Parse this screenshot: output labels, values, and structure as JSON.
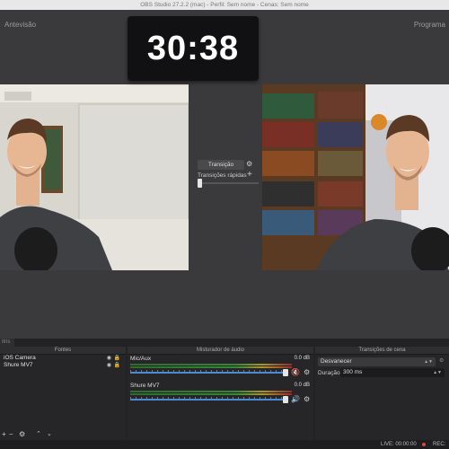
{
  "window": {
    "title": "OBS Studio 27.2.2 (mac) - Perfil: Sem nome - Cenas: Sem nome"
  },
  "preview_label": "Antevisão",
  "program_label": "Programa",
  "timer": "30:38",
  "transition": {
    "button_label": "Transição",
    "quick_label": "Transições rápidas"
  },
  "dock": {
    "tab_label": "itris",
    "sources": {
      "title": "Fontes",
      "items": [
        "iOS Camera",
        "Shure MV7"
      ]
    },
    "mixer": {
      "title": "Misturador de áudio",
      "channels": [
        {
          "name": "Mic/Aux",
          "db": "0.0 dB",
          "muted": true
        },
        {
          "name": "Shure MV7",
          "db": "0.0 dB",
          "muted": false
        }
      ]
    },
    "scene_transitions": {
      "title": "Transições de cena",
      "selected": "Desvanecer",
      "duration_label": "Duração",
      "duration_value": "300 ms"
    }
  },
  "status": {
    "live": "LIVE: 00:00:00",
    "rec": "REC: 0"
  },
  "colors": {
    "accent": "#4a8bd6",
    "muted": "#d44040",
    "background": "#3a3a3c"
  }
}
